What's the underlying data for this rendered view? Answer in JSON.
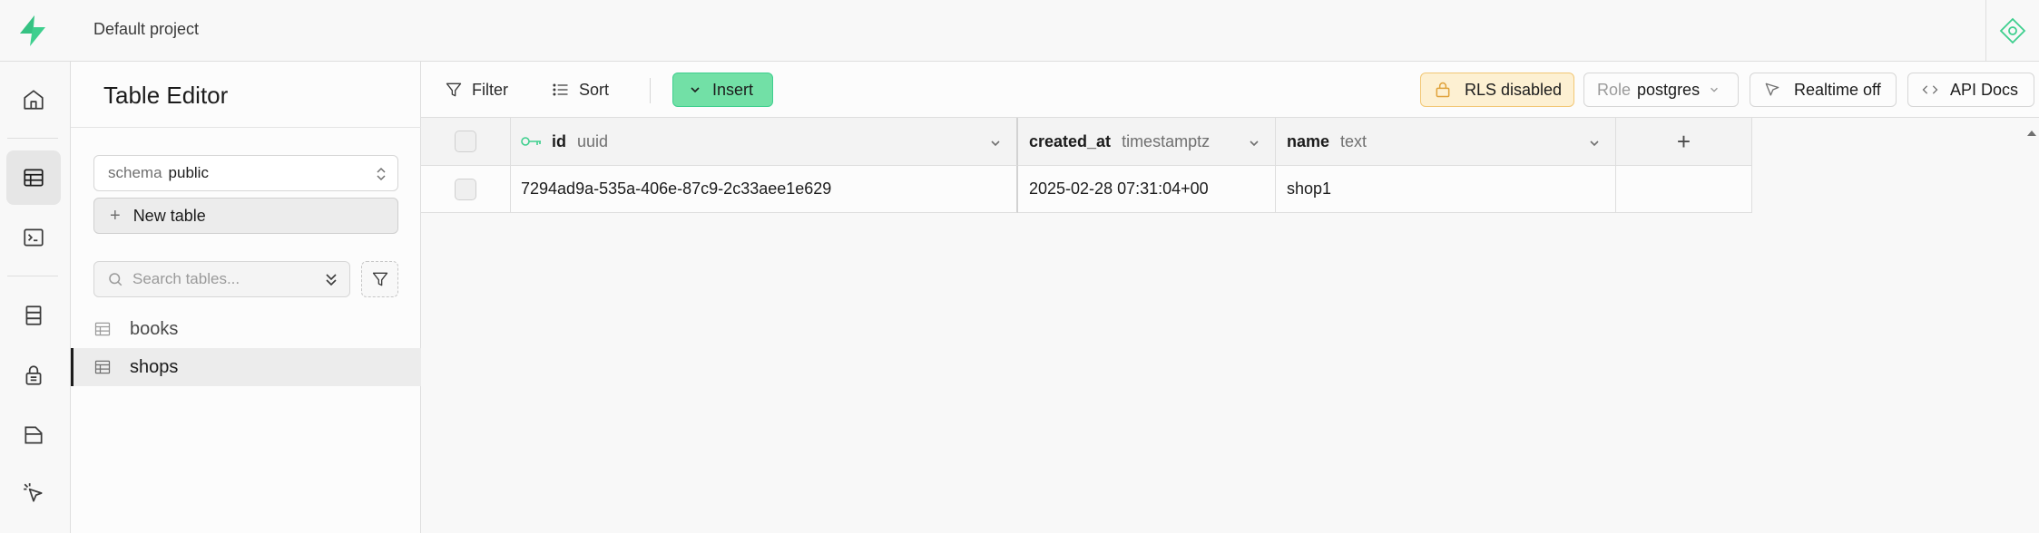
{
  "app": {
    "project_name": "Default project",
    "brand_color": "#3ecf8e"
  },
  "rail": {
    "items": [
      {
        "name": "home",
        "icon": "home-icon",
        "active": false
      },
      {
        "name": "table-editor",
        "icon": "table-icon",
        "active": true
      },
      {
        "name": "sql-editor",
        "icon": "terminal-icon",
        "active": false
      },
      {
        "name": "database",
        "icon": "database-icon",
        "active": false
      },
      {
        "name": "authentication",
        "icon": "lock-icon",
        "active": false
      },
      {
        "name": "storage",
        "icon": "archive-icon",
        "active": false
      },
      {
        "name": "realtime",
        "icon": "cursor-icon",
        "active": false
      }
    ]
  },
  "sidebar": {
    "title": "Table Editor",
    "schema_label": "schema",
    "schema_value": "public",
    "new_table_label": "New table",
    "search_placeholder": "Search tables...",
    "tables": [
      {
        "name": "books",
        "active": false
      },
      {
        "name": "shops",
        "active": true
      }
    ]
  },
  "toolbar": {
    "filter_label": "Filter",
    "sort_label": "Sort",
    "insert_label": "Insert",
    "rls_label": "RLS disabled",
    "role_label": "Role",
    "role_value": "postgres",
    "realtime_label": "Realtime off",
    "api_docs_label": "API Docs"
  },
  "grid": {
    "columns": [
      {
        "name": "id",
        "type": "uuid",
        "primary_key": true
      },
      {
        "name": "created_at",
        "type": "timestamptz",
        "primary_key": false
      },
      {
        "name": "name",
        "type": "text",
        "primary_key": false
      }
    ],
    "add_column_label": "+",
    "rows": [
      {
        "id": "7294ad9a-535a-406e-87c9-2c33aee1e629",
        "created_at": "2025-02-28 07:31:04+00",
        "name": "shop1"
      }
    ]
  }
}
